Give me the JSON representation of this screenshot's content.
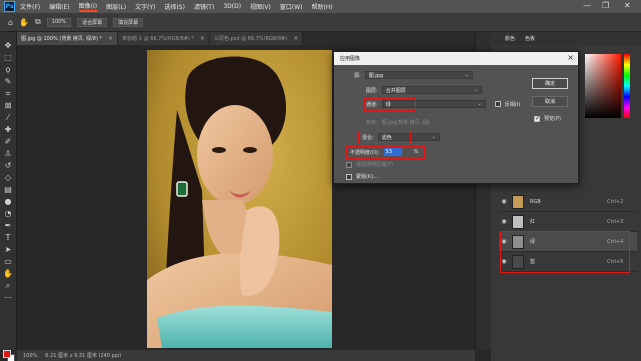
{
  "menu": {
    "logo": "Ps",
    "items": [
      "文件(F)",
      "编辑(E)",
      "图像(I)",
      "图层(L)",
      "文字(Y)",
      "选择(S)",
      "滤镜(T)",
      "3D(D)",
      "视图(V)",
      "窗口(W)",
      "帮助(H)"
    ],
    "active_index": 2
  },
  "window_controls": {
    "minimize": "—",
    "restore": "❐",
    "close": "✕"
  },
  "options": {
    "zoom_value": "100%",
    "fit_screen": "适合屏幕",
    "fill_screen": "填充屏幕"
  },
  "tabs": [
    {
      "label": "图.jpg @ 100% (背景 拷贝, 绿/8) *"
    },
    {
      "label": "未标题-1 @ 66.7%(RGB/8#) *"
    },
    {
      "label": "三原色.psd @ 66.7%(RGB/8#)"
    }
  ],
  "status": {
    "zoom": "100%",
    "doc": "6.21 厘米 x 9.31 厘米 (240 ppi)"
  },
  "right_panel": {
    "tab_color": "颜色",
    "tab_swatches": "色板"
  },
  "layers": [
    {
      "name": "RGB",
      "shortcut": "Ctrl+2"
    },
    {
      "name": "红",
      "shortcut": "Ctrl+3"
    },
    {
      "name": "绿",
      "shortcut": "Ctrl+4"
    },
    {
      "name": "蓝",
      "shortcut": "Ctrl+5"
    }
  ],
  "dialog": {
    "title": "应用图像",
    "source_label": "源:",
    "source_value": "图.jpg",
    "layer_label": "图层:",
    "layer_value": "合并图层",
    "channel_label": "通道:",
    "channel_value": "绿",
    "invert_label": "反相(I)",
    "target_label": "目标:",
    "target_value": "图.jpg(背景 拷贝, 绿)",
    "blend_label": "混合:",
    "blend_value": "滤色",
    "opacity_label": "不透明度(O):",
    "opacity_value": "53",
    "opacity_unit": "%",
    "preserve_label": "保留透明区域(T)",
    "mask_label": "蒙版(K)...",
    "ok": "确定",
    "cancel": "取消",
    "preview": "预览(P)"
  }
}
